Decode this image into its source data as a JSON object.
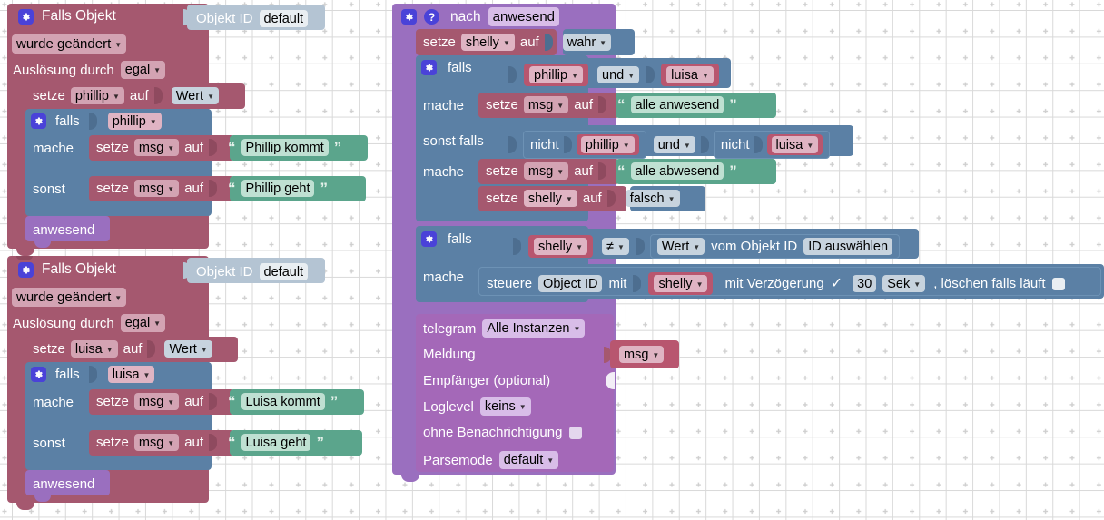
{
  "app": {
    "type": "blockly-visual-script-editor",
    "language": "de",
    "colors": {
      "trigger_rose": "#a5586f",
      "logic_blue": "#5b80a5",
      "text_green": "#5ba58c",
      "function_purple": "#9a6fbf",
      "object_lightblue": "#b4c4d3",
      "variable_pink": "#b8566f",
      "gear_icon": "#4a42d8",
      "canvas_background": "#ffffff",
      "grid_dot": "#cccccc"
    }
  },
  "blocks": {
    "trigger_phillip": {
      "title": "Falls Objekt",
      "gear_icon": "gear-icon",
      "object_id_label": "Objekt ID",
      "object_id_value": "default",
      "change_mode": "wurde geändert",
      "trigger_by_label": "Auslösung durch",
      "trigger_by_value": "egal",
      "set_label": "setze",
      "set_var": "phillip",
      "set_to_label": "auf",
      "set_value": "Wert",
      "if_label": "falls",
      "if_condition": "phillip",
      "do_label": "mache",
      "do_set_label": "setze",
      "do_set_var": "msg",
      "do_set_to": "auf",
      "do_text": "Phillip kommt",
      "else_label": "sonst",
      "else_set_label": "setze",
      "else_set_var": "msg",
      "else_set_to": "auf",
      "else_text": "Phillip geht",
      "call_function": "anwesend"
    },
    "trigger_luisa": {
      "title": "Falls Objekt",
      "gear_icon": "gear-icon",
      "object_id_label": "Objekt ID",
      "object_id_value": "default",
      "change_mode": "wurde geändert",
      "trigger_by_label": "Auslösung durch",
      "trigger_by_value": "egal",
      "set_label": "setze",
      "set_var": "luisa",
      "set_to_label": "auf",
      "set_value": "Wert",
      "if_label": "falls",
      "if_condition": "luisa",
      "do_label": "mache",
      "do_set_label": "setze",
      "do_set_var": "msg",
      "do_set_to": "auf",
      "do_text": "Luisa kommt",
      "else_label": "sonst",
      "else_set_label": "setze",
      "else_set_var": "msg",
      "else_set_to": "auf",
      "else_text": "Luisa geht",
      "call_function": "anwesend"
    },
    "function_anwesend": {
      "gear_icon": "gear-icon",
      "help_icon": "help-icon",
      "keyword": "nach",
      "name": "anwesend",
      "set_shelly": {
        "set_label": "setze",
        "var": "shelly",
        "to_label": "auf",
        "value": "wahr"
      },
      "if_block_1": {
        "gear_icon": "gear-icon",
        "if_label": "falls",
        "cond_a": "phillip",
        "operator": "und",
        "cond_b": "luisa",
        "do_label": "mache",
        "do_set_label": "setze",
        "do_set_var": "msg",
        "do_set_to": "auf",
        "do_text": "alle anwesend",
        "elseif_label": "sonst falls",
        "elseif_not_a": "nicht",
        "elseif_a": "phillip",
        "elseif_operator": "und",
        "elseif_not_b": "nicht",
        "elseif_b": "luisa",
        "elseif_do_label": "mache",
        "elseif_set_label": "setze",
        "elseif_set_var": "msg",
        "elseif_set_to": "auf",
        "elseif_text": "alle abwesend",
        "elseif_set2_label": "setze",
        "elseif_set2_var": "shelly",
        "elseif_set2_to": "auf",
        "elseif_set2_value": "falsch"
      },
      "if_block_2": {
        "gear_icon": "gear-icon",
        "if_label": "falls",
        "left": "shelly",
        "operator": "≠",
        "right_value": "Wert",
        "from_object_label": "vom Objekt ID",
        "from_object_id": "ID auswählen",
        "do_label": "mache",
        "control_label": "steuere",
        "control_object": "Object ID",
        "with_label": "mit",
        "control_value": "shelly",
        "delay_label": "mit Verzögerung",
        "delay_checked": true,
        "delay_value": "30",
        "delay_unit": "Sek",
        "clear_label": ", löschen falls läuft",
        "clear_checked": false
      },
      "telegram": {
        "title": "telegram",
        "instance": "Alle Instanzen",
        "message_label": "Meldung",
        "message_value": "msg",
        "recipient_label": "Empfänger (optional)",
        "loglevel_label": "Loglevel",
        "loglevel_value": "keins",
        "silent_label": "ohne Benachrichtigung",
        "silent_checked": false,
        "parsemode_label": "Parsemode",
        "parsemode_value": "default"
      }
    }
  }
}
